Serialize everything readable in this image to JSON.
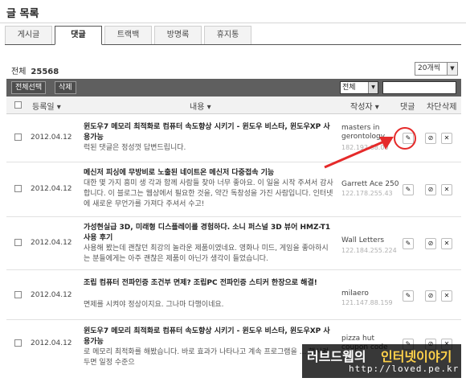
{
  "page": {
    "title": "글 목록"
  },
  "tabs": [
    "게시글",
    "댓글",
    "트랙백",
    "방명록",
    "휴지통"
  ],
  "summary": {
    "label": "전체",
    "count": "25568"
  },
  "per_page": "20개씩",
  "toolbar": {
    "select_all": "전체선택",
    "delete": "삭제",
    "filter": "전체"
  },
  "columns": {
    "date": "등록일",
    "content": "내용",
    "author": "작성자",
    "comment": "댓글",
    "block": "차단",
    "delete": "삭제"
  },
  "rows": [
    {
      "date": "2012.04.12",
      "title": "윈도우7 메모리 최적화로 컴퓨터 속도향상 시키기 - 윈도우 비스타, 윈도우XP 사용가능",
      "body": "럭된 댓글은 정성껏 답변드립니다.",
      "author": "masters in gerontology",
      "ip": "182.192.88.00"
    },
    {
      "date": "2012.04.12",
      "title": "메신저 피싱에 무방비로 노출된 네이트온 메신저 다중접속 기능",
      "body": "대한 몇 가지 흥미 생 각과 함께 사람들 찾아 너무 좋아요. 이 일을 시작 주셔서 감사합니다. 이 블로그는 웹상에서 필요한 것을, 약간 독창성을 가진 사람입니다. 인터넷에 새로운 무언가를 가져다 주셔서 수고!",
      "author": "Garrett Ace 250",
      "ip": "122.178.255.43"
    },
    {
      "date": "2012.04.12",
      "title": "가성현실급 3D, 미래형 디스플레이를 경험하다. 소니 퍼스널 3D 뷰어 HMZ-T1 사용 후기",
      "body": "사용해 봤는데 괜찮던 최강의 놀라운 제품이였네요. 영화나 미드, 게임을 좋아하시는 분들에게는 아주 괜찮은 제품이 아닌가 생각이 들었습니다.",
      "author": "Wall Letters",
      "ip": "122.184.255.224"
    },
    {
      "date": "2012.04.12",
      "title": "조립 컴퓨터 전파인증 조건부 면제? 조립PC 전파인증 스티커 한장으로 해결!",
      "body": "면제를 시켜야 정상이지요. 그나마 다행이네요.",
      "author": "milaero",
      "ip": "121.147.88.159"
    },
    {
      "date": "2012.04.12",
      "title": "윈도우7 메모리 최적화로 컴퓨터 속도향상 시키기 - 윈도우 비스타, 윈도우XP 사용가능",
      "body": "로 메모리 최적화를 해봤습니다. 바로 효과가 나타나고 계속 프로그램을 ... 행시켜두면 일정 수준으",
      "author": "pizza hut coupon code",
      "ip": ""
    }
  ],
  "watermark": {
    "left": "러브드웹의",
    "right": "인터넷이야기",
    "url": "http://loved.pe.kr"
  },
  "colors": {
    "toolbar": "#5f5f5f",
    "callout": "#e52a2a",
    "watermark_accent": "#ffd24a"
  },
  "icons": {
    "edit": "pencil-icon",
    "block": "block-icon",
    "delete": "close-icon"
  }
}
